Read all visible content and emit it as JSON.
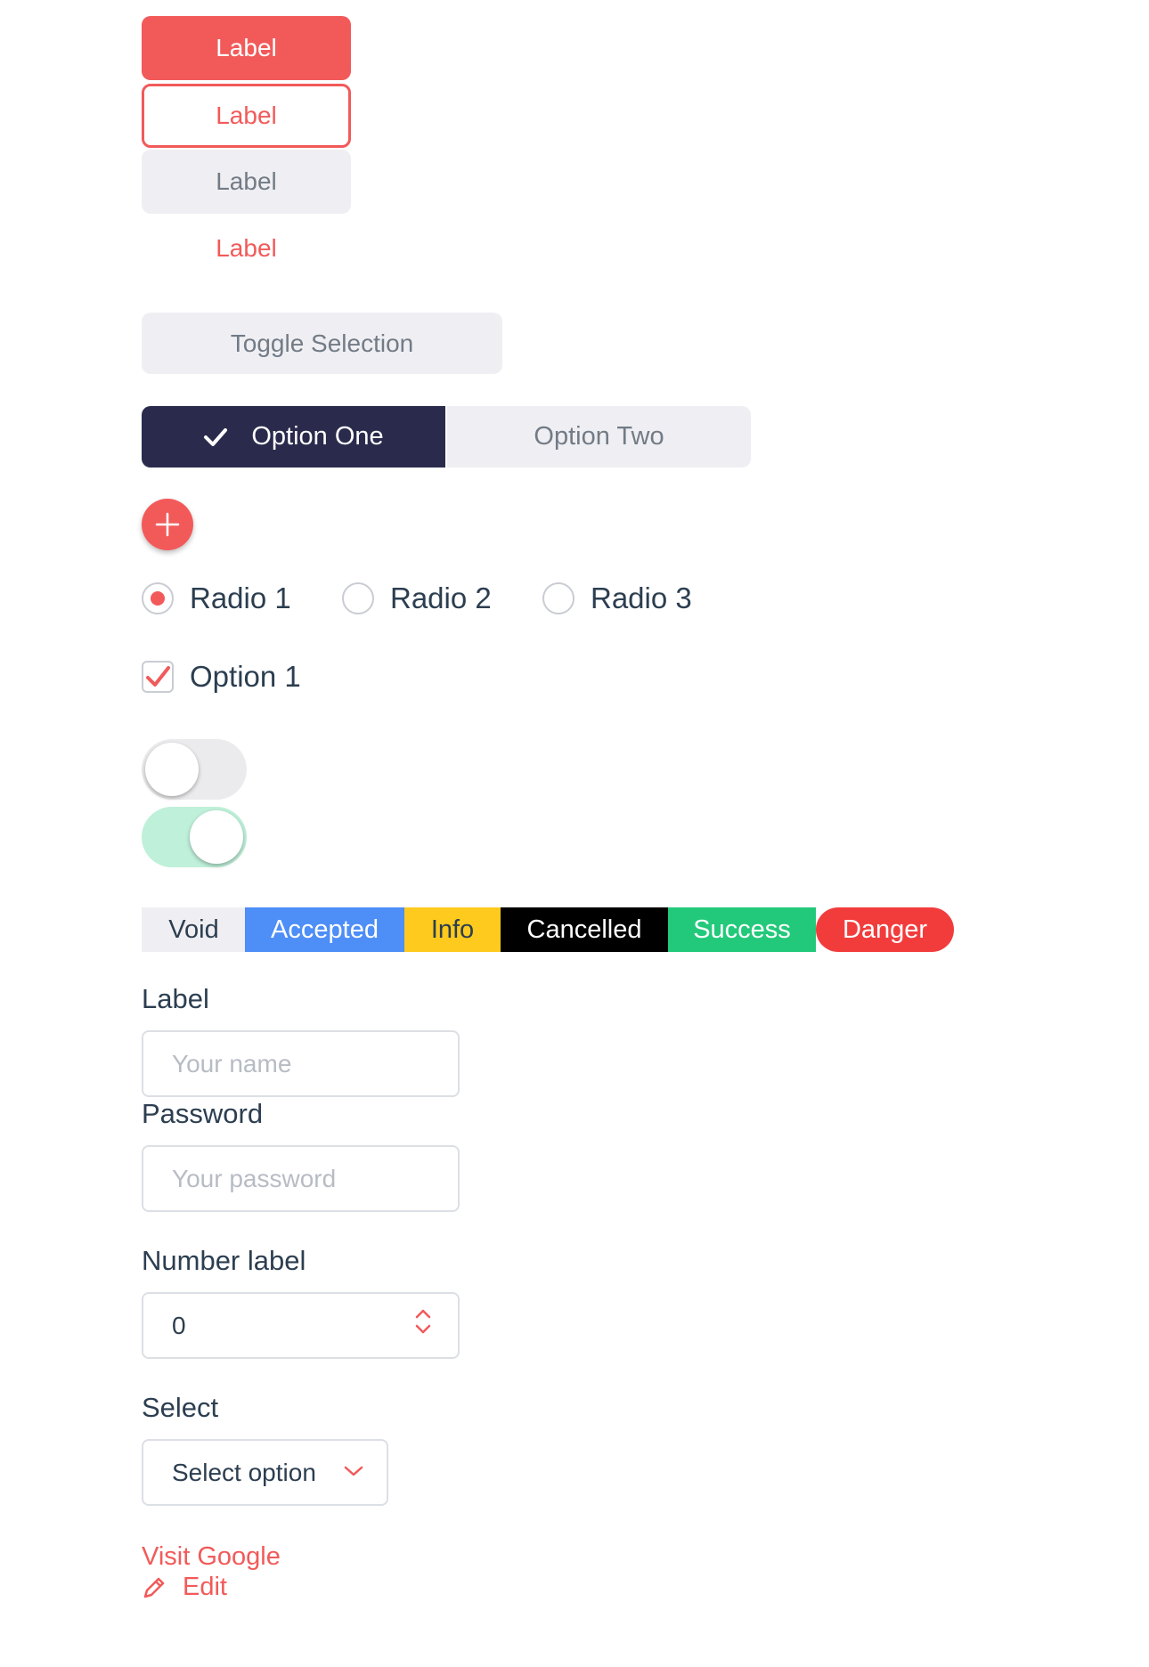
{
  "buttons": {
    "primary_label": "Label",
    "outline_label": "Label",
    "light_label": "Label",
    "text_label": "Label"
  },
  "toggle_selection": {
    "label": "Toggle Selection"
  },
  "segmented": {
    "options": [
      {
        "label": "Option One",
        "selected": true
      },
      {
        "label": "Option Two",
        "selected": false
      }
    ]
  },
  "fab": {
    "icon": "plus-icon"
  },
  "radios": [
    {
      "label": "Radio 1",
      "checked": true
    },
    {
      "label": "Radio 2",
      "checked": false
    },
    {
      "label": "Radio 3",
      "checked": false
    }
  ],
  "checkbox": {
    "label": "Option 1",
    "checked": true
  },
  "switches": [
    {
      "on": false
    },
    {
      "on": true
    }
  ],
  "badges": [
    {
      "label": "Void",
      "bg": "#efeff3",
      "fg": "#2c3e50"
    },
    {
      "label": "Accepted",
      "bg": "#4d8ef7",
      "fg": "#ffffff"
    },
    {
      "label": "Info",
      "bg": "#fdca1d",
      "fg": "#2c3e50"
    },
    {
      "label": "Cancelled",
      "bg": "#000000",
      "fg": "#ffffff"
    },
    {
      "label": "Success",
      "bg": "#22c97a",
      "fg": "#ffffff"
    },
    {
      "label": "Danger",
      "bg": "#f23c3c",
      "fg": "#ffffff"
    }
  ],
  "form": {
    "name": {
      "label": "Label",
      "placeholder": "Your name",
      "value": ""
    },
    "password": {
      "label": "Password",
      "placeholder": "Your password",
      "value": ""
    },
    "number": {
      "label": "Number label",
      "value": "0"
    },
    "select": {
      "label": "Select",
      "selected": "Select option"
    }
  },
  "links": {
    "visit": "Visit Google",
    "edit": "Edit"
  },
  "colors": {
    "accent": "#f25a5a",
    "dark": "#2a2b4c",
    "light": "#efeff3",
    "text": "#2c3e50",
    "success_light": "#bff0d9"
  }
}
